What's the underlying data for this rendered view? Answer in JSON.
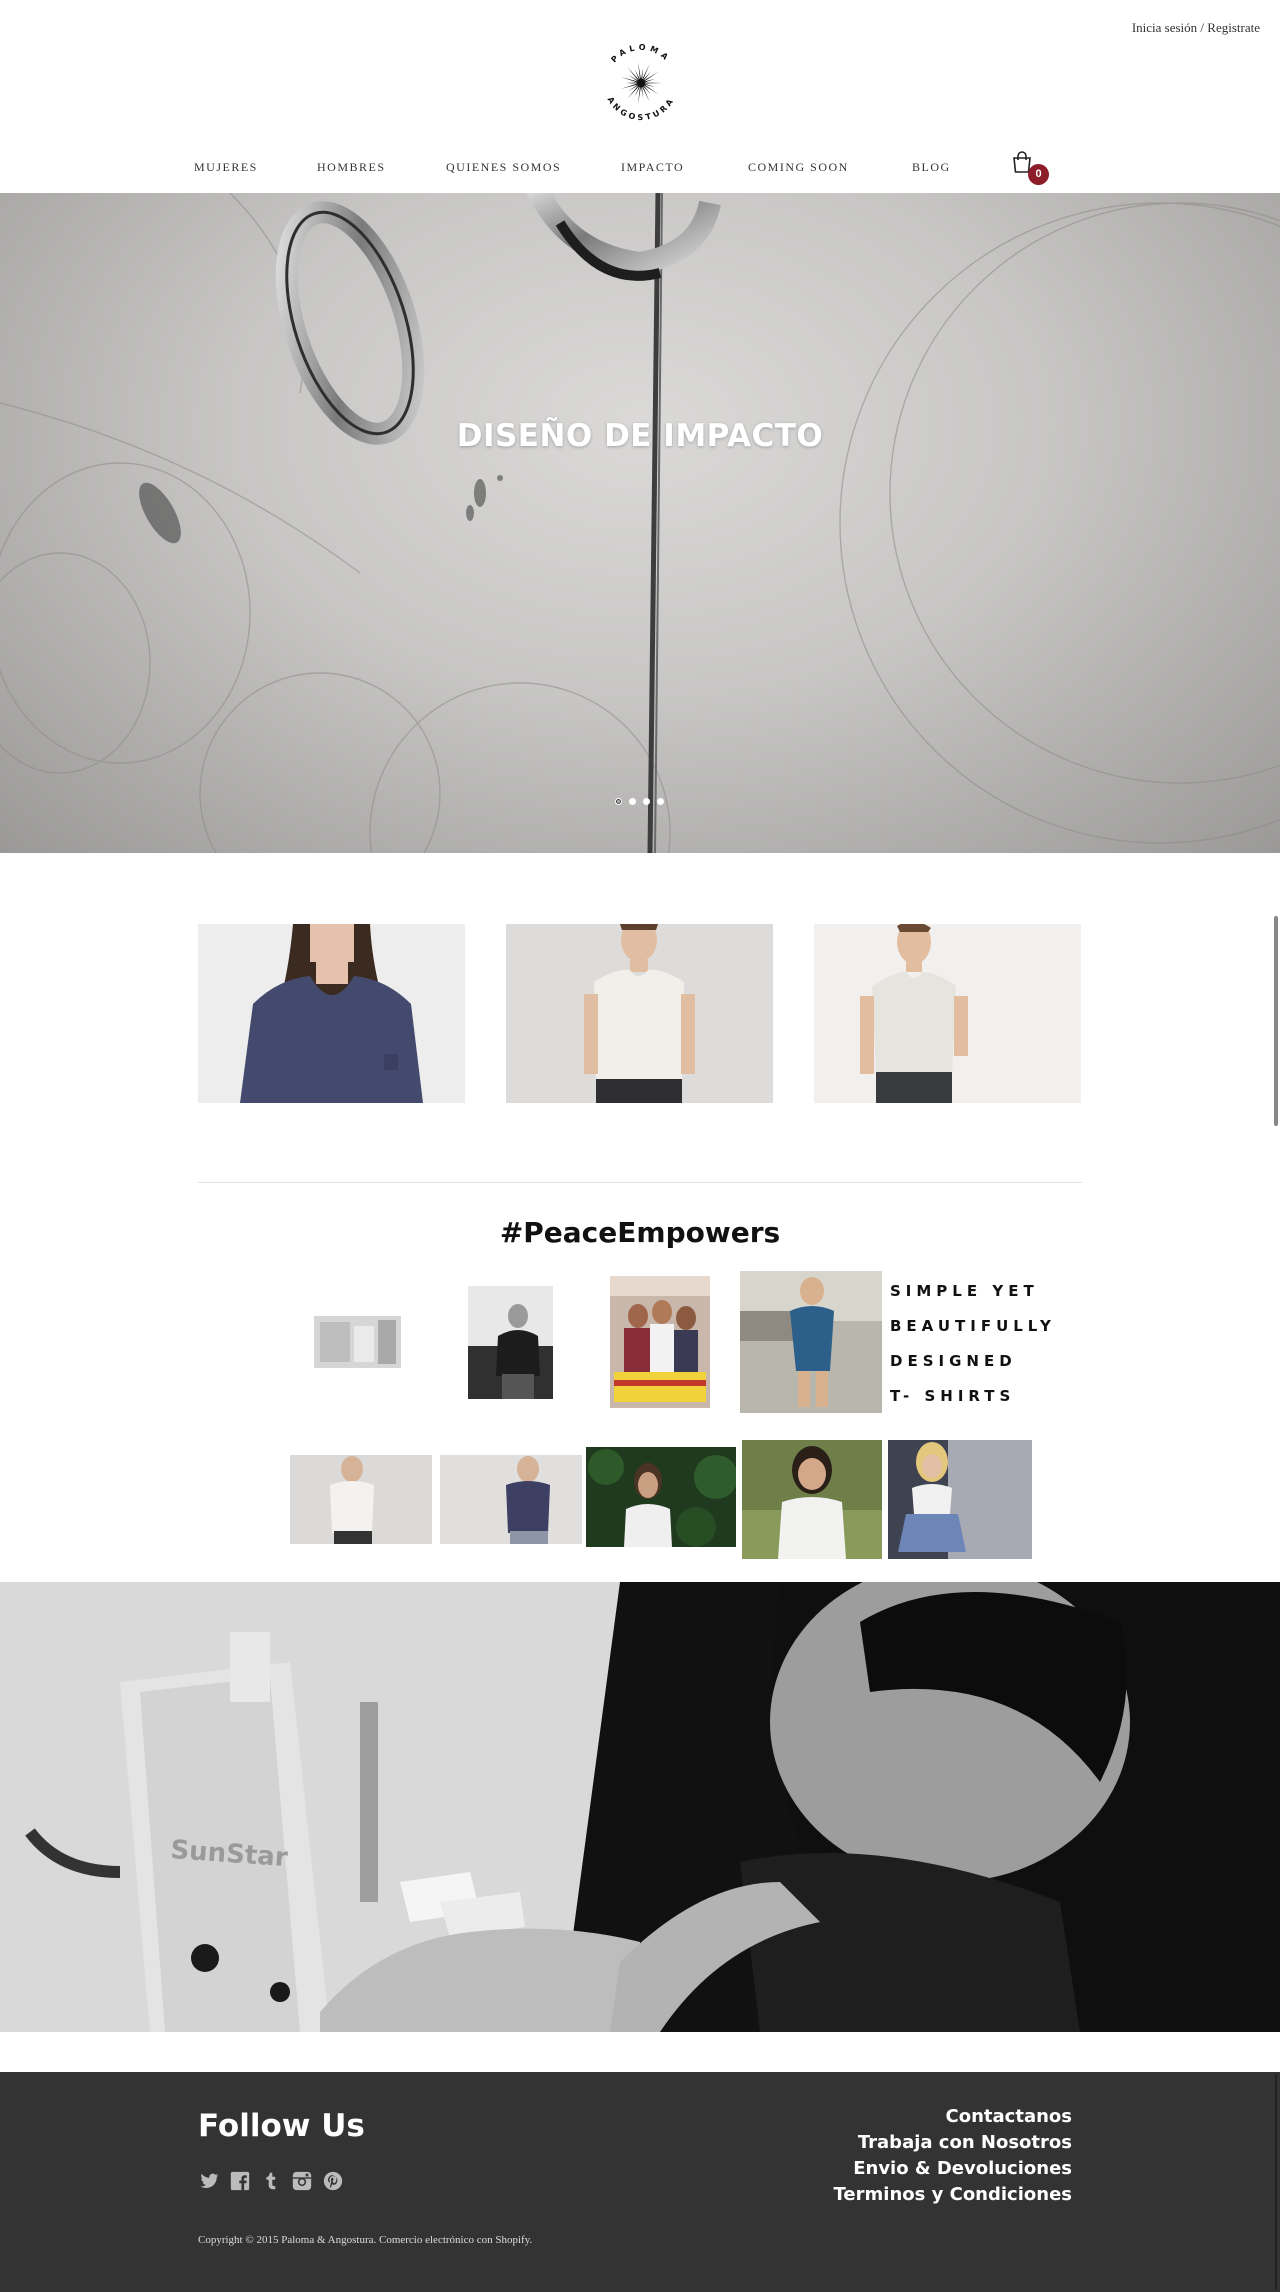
{
  "header": {
    "login_link": "Inicia sesión",
    "separator": "/",
    "register_link": "Registrate",
    "logo_text_top": "PALOMA",
    "logo_text_bottom": "ANGOSTURA"
  },
  "nav": {
    "items": [
      "MUJERES",
      "HOMBRES",
      "QUIENES SOMOS",
      "IMPACTO",
      "COMING SOON",
      "BLOG"
    ],
    "cart_count": "0",
    "cart_icon": "shopping-bag-icon"
  },
  "hero": {
    "title": "DISEÑO DE IMPACTO",
    "slide_count": 4,
    "active_slide": 1
  },
  "products": [
    {
      "image": "woman-navy-tshirt"
    },
    {
      "image": "man-white-tshirt-front"
    },
    {
      "image": "man-white-tshirt-pose"
    }
  ],
  "instagram": {
    "title": "#PeaceEmpowers",
    "tagline": [
      "SIMPLE YET",
      "BEAUTIFULLY",
      "DESIGNED",
      "T- SHIRTS"
    ]
  },
  "footer": {
    "follow_title": "Follow Us",
    "social_icons": [
      "twitter-icon",
      "facebook-icon",
      "tumblr-icon",
      "instagram-icon",
      "pinterest-icon"
    ],
    "links": [
      "Contactanos",
      "Trabaja con Nosotros",
      "Envio & Devoluciones",
      "Terminos y Condiciones"
    ],
    "copyright": "Copyright © 2015 Paloma & Angostura. Comercio electrónico con Shopify."
  },
  "colors": {
    "accent": "#8e1d2a",
    "footer_bg": "#333333"
  }
}
